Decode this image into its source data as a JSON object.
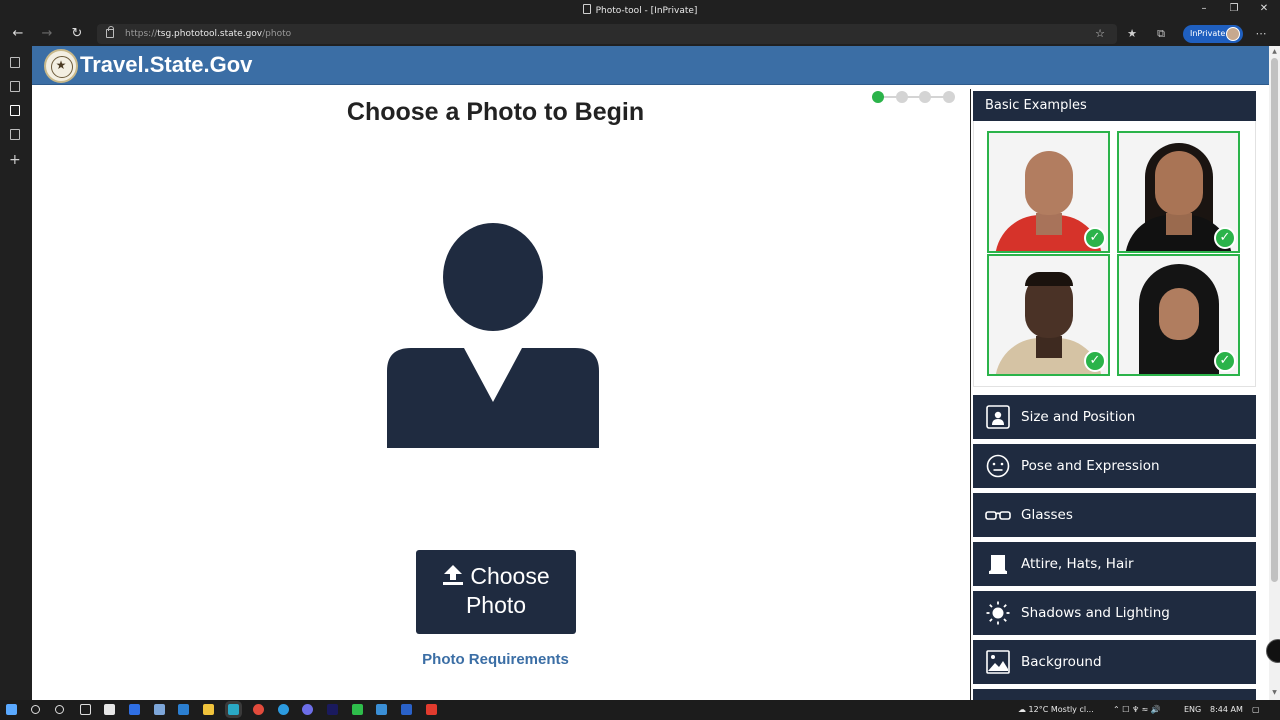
{
  "window": {
    "title": "Photo-tool - [InPrivate]",
    "minimize": "–",
    "maximize": "❐",
    "close": "✕"
  },
  "browser": {
    "url_prefix": "https://",
    "url_host": "tsg.phototool.state.gov",
    "url_path": "/photo",
    "inprivate_label": "InPrivate"
  },
  "site": {
    "brand": "Travel.State.Gov"
  },
  "main": {
    "heading": "Choose a Photo to Begin",
    "progress": {
      "current_step": 1,
      "total_steps": 4
    },
    "choose_button_line1": "Choose",
    "choose_button_line2": "Photo",
    "requirements_link": "Photo Requirements"
  },
  "panel": {
    "examples_title": "Basic Examples",
    "examples": [
      {
        "subject": "bald man in red shirt",
        "approved": true
      },
      {
        "subject": "woman with dark hair",
        "approved": true
      },
      {
        "subject": "man in beige shirt",
        "approved": true
      },
      {
        "subject": "woman in black hijab",
        "approved": true
      }
    ],
    "categories": [
      {
        "label": "Size and Position",
        "icon": "portrait-frame-icon"
      },
      {
        "label": "Pose and Expression",
        "icon": "neutral-face-icon"
      },
      {
        "label": "Glasses",
        "icon": "glasses-icon"
      },
      {
        "label": "Attire, Hats, Hair",
        "icon": "hat-icon"
      },
      {
        "label": "Shadows and Lighting",
        "icon": "sun-icon"
      },
      {
        "label": "Background",
        "icon": "image-icon"
      }
    ]
  },
  "taskbar": {
    "weather": "12°C  Mostly cl...",
    "language": "ENG",
    "time": "8:44 AM"
  }
}
